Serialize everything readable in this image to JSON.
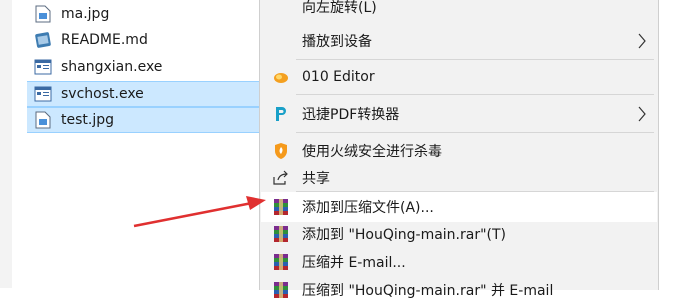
{
  "files": [
    {
      "name": "ma.jpg",
      "icon": "image-file-icon",
      "selected": false
    },
    {
      "name": "README.md",
      "icon": "markdown-file-icon",
      "selected": false
    },
    {
      "name": "shangxian.exe",
      "icon": "executable-file-icon",
      "selected": false
    },
    {
      "name": "svchost.exe",
      "icon": "executable-file-icon",
      "selected": true
    },
    {
      "name": "test.jpg",
      "icon": "image-file-icon",
      "selected": true
    }
  ],
  "menu": {
    "items": [
      {
        "label": "向左旋转(L)",
        "icon": "",
        "submenu": false
      },
      {
        "label": "播放到设备",
        "icon": "",
        "submenu": true
      },
      {
        "label": "010 Editor",
        "icon": "010-editor-icon",
        "submenu": false
      },
      {
        "label": "迅捷PDF转换器",
        "icon": "pdf-converter-icon",
        "submenu": true
      },
      {
        "label": "使用火绒安全进行杀毒",
        "icon": "huorong-shield-icon",
        "submenu": false
      },
      {
        "label": "共享",
        "icon": "share-icon",
        "submenu": false
      },
      {
        "label": "添加到压缩文件(A)...",
        "icon": "winrar-icon",
        "submenu": false,
        "highlighted": true
      },
      {
        "label": "添加到 \"HouQing-main.rar\"(T)",
        "icon": "winrar-icon",
        "submenu": false
      },
      {
        "label": "压缩并 E-mail...",
        "icon": "winrar-icon",
        "submenu": false
      },
      {
        "label": "压缩到 \"HouQing-main.rar\" 并 E-mail",
        "icon": "winrar-icon",
        "submenu": false
      }
    ]
  },
  "colors": {
    "selection": "#cce8ff",
    "menu_bg": "#f2f2f2",
    "highlight": "#ffffff",
    "annotation_arrow": "#e03030"
  }
}
